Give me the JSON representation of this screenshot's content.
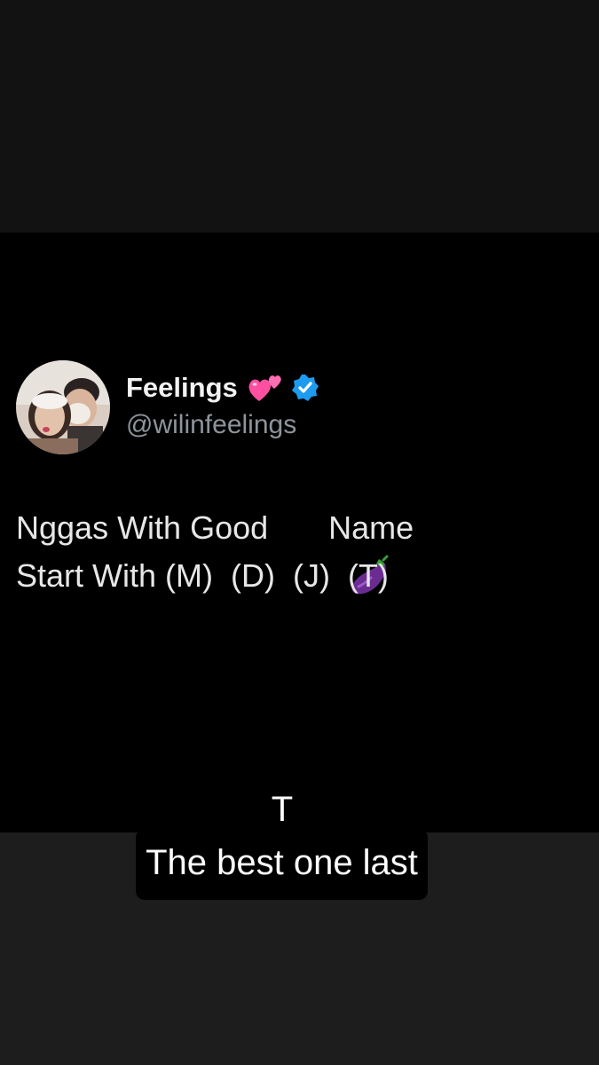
{
  "post": {
    "author_name": "Feelings",
    "author_handle": "@wilinfeelings",
    "name_emoji_icon": "two-hearts-icon",
    "verified_icon": "verified-badge-icon",
    "avatar_icon": "couple-profile-photo",
    "text_line1_before": "Nggas With Good",
    "text_emoji_icon": "eggplant-icon",
    "text_line1_after": "Name",
    "text_line2": "Start With (M)  (D)  (J)  (T)"
  },
  "captions": {
    "line1": "T",
    "line2": "The best one last"
  },
  "colors": {
    "background": "#000000",
    "top_band": "#121212",
    "bottom_band": "#1d1d1d",
    "verified_blue": "#1d9bf0",
    "handle_gray": "#8d949b",
    "text": "#e7e7e7"
  }
}
